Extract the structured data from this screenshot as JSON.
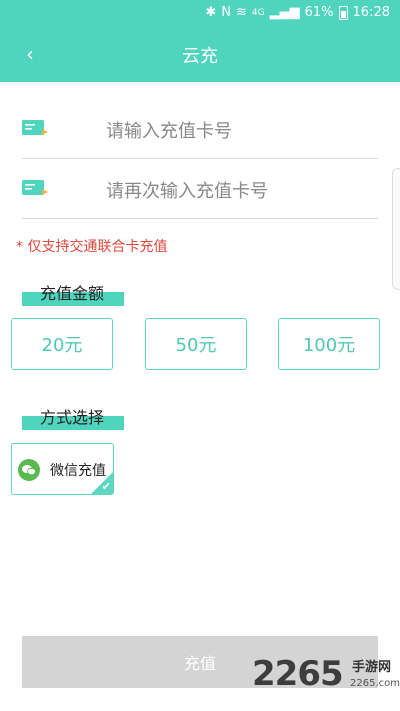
{
  "status_bar": {
    "battery": "61%",
    "time": "16:28",
    "network": "4G"
  },
  "header": {
    "back_icon": "chevron-left-icon",
    "title": "云充",
    "bg_color": "#4fd4bd"
  },
  "form": {
    "card_input_placeholder": "请输入充值卡号",
    "card_confirm_placeholder": "请再次输入充值卡号",
    "notice": "* 仅支持交通联合卡充值"
  },
  "amount_section": {
    "title": "充值金额",
    "options": [
      "20元",
      "50元",
      "100元"
    ]
  },
  "payment_section": {
    "title": "方式选择",
    "method": "微信充值",
    "method_icon": "wechat-icon",
    "selected": true
  },
  "submit": {
    "label": "充值"
  },
  "watermark": {
    "number": "2265",
    "suffix": "手游网",
    "domain": "2265.com"
  }
}
